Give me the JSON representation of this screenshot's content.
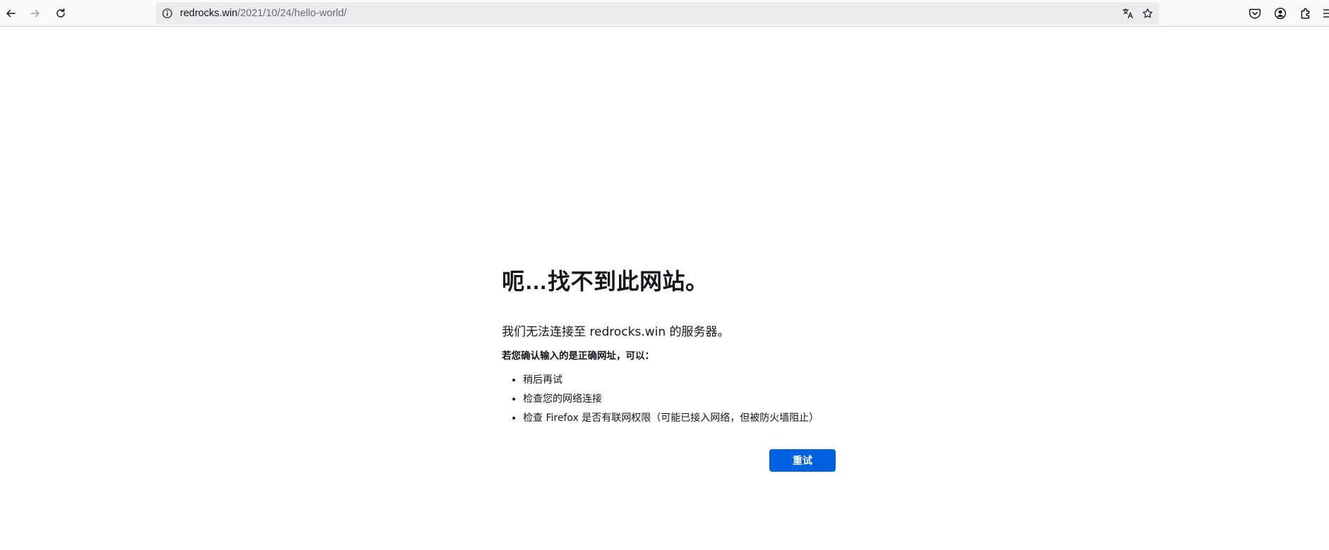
{
  "browser": {
    "url_host": "redrocks.win",
    "url_path": "/2021/10/24/hello-world/",
    "icons": {
      "back": "back-arrow-icon",
      "forward": "forward-arrow-icon",
      "reload": "reload-icon",
      "site_info": "info-icon",
      "translate": "translate-icon",
      "bookmark": "bookmark-star-icon",
      "pocket": "pocket-icon",
      "account": "account-icon",
      "extensions": "extensions-icon",
      "menu": "menu-icon"
    }
  },
  "error_page": {
    "title": "呃…找不到此网站。",
    "description": "我们无法连接至 redrocks.win 的服务器。",
    "suggestions_title": "若您确认输入的是正确网址，可以：",
    "suggestions": [
      "稍后再试",
      "检查您的网络连接",
      "检查 Firefox 是否有联网权限（可能已接入网络，但被防火墙阻止）"
    ],
    "retry_label": "重试"
  },
  "colors": {
    "accent": "#0061e0",
    "toolbar_bg": "#f9f9fb",
    "urlbar_bg": "#ececef"
  }
}
